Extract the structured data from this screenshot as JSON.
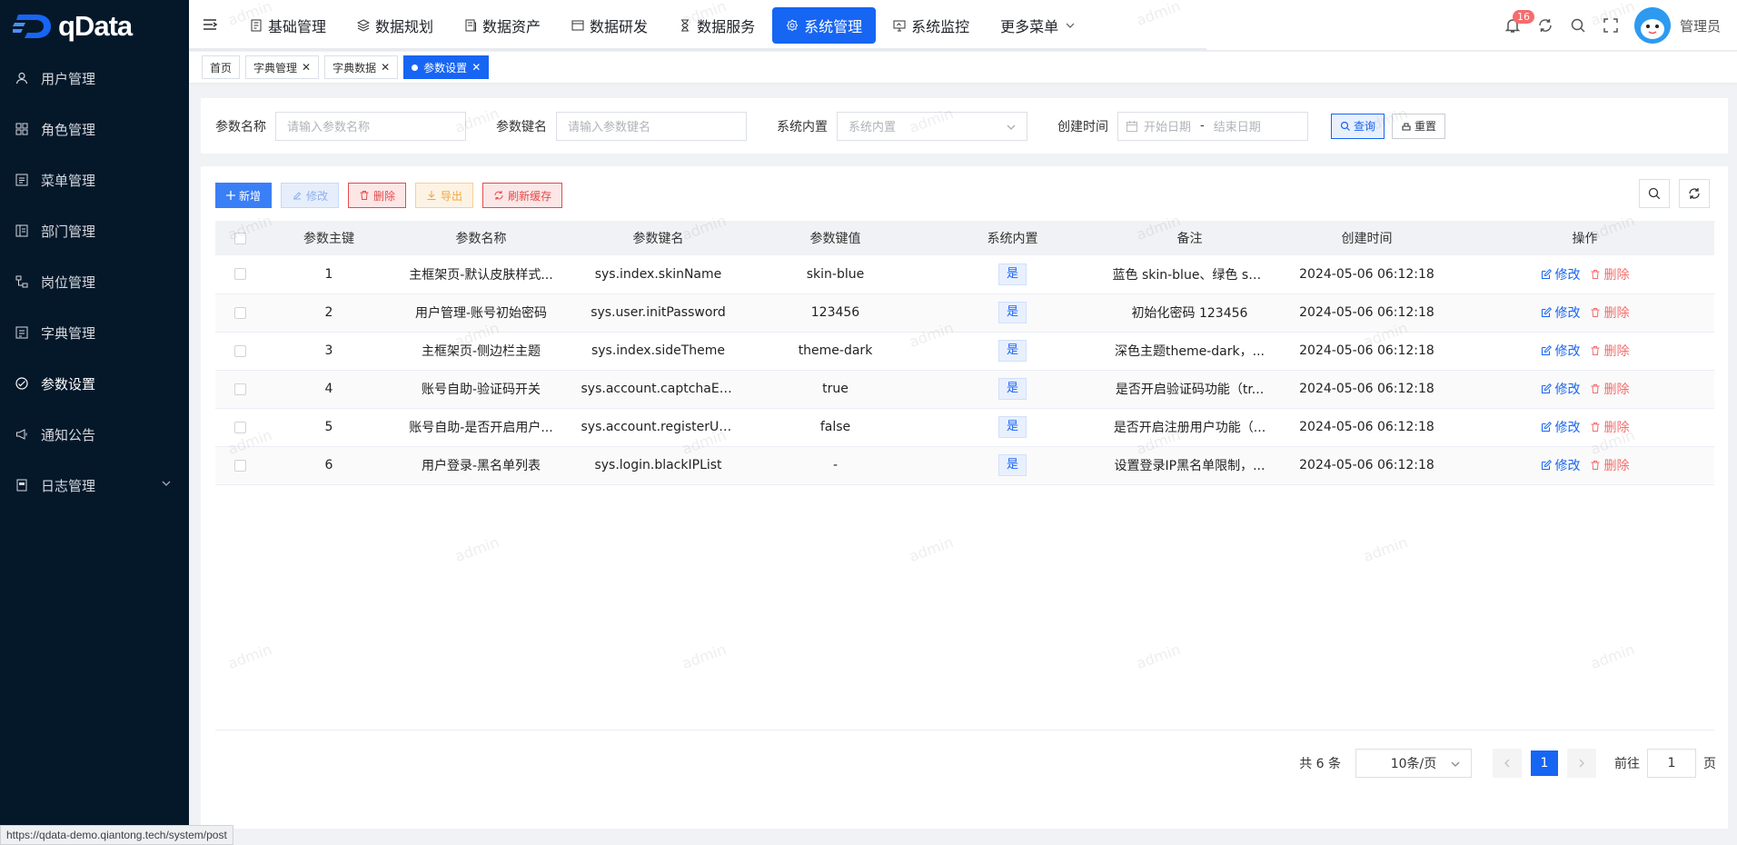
{
  "app": {
    "name": "qData",
    "watermark": "admin"
  },
  "sidebar": {
    "items": [
      {
        "label": "用户管理",
        "icon": "user-icon"
      },
      {
        "label": "角色管理",
        "icon": "role-icon"
      },
      {
        "label": "菜单管理",
        "icon": "menu-icon"
      },
      {
        "label": "部门管理",
        "icon": "dept-icon"
      },
      {
        "label": "岗位管理",
        "icon": "post-icon"
      },
      {
        "label": "字典管理",
        "icon": "dict-icon"
      },
      {
        "label": "参数设置",
        "icon": "config-icon",
        "active": true
      },
      {
        "label": "通知公告",
        "icon": "notice-icon"
      },
      {
        "label": "日志管理",
        "icon": "log-icon",
        "expandable": true
      }
    ]
  },
  "nav": {
    "items": [
      {
        "label": "基础管理"
      },
      {
        "label": "数据规划"
      },
      {
        "label": "数据资产"
      },
      {
        "label": "数据研发"
      },
      {
        "label": "数据服务"
      },
      {
        "label": "系统管理",
        "active": true
      },
      {
        "label": "系统监控"
      },
      {
        "label": "更多菜单"
      }
    ]
  },
  "header": {
    "notification_count": "16",
    "username": "管理员"
  },
  "tabs": [
    {
      "label": "首页"
    },
    {
      "label": "字典管理"
    },
    {
      "label": "字典数据"
    },
    {
      "label": "参数设置",
      "active": true
    }
  ],
  "search": {
    "name_label": "参数名称",
    "name_placeholder": "请输入参数名称",
    "key_label": "参数键名",
    "key_placeholder": "请输入参数键名",
    "builtin_label": "系统内置",
    "builtin_placeholder": "系统内置",
    "time_label": "创建时间",
    "start_placeholder": "开始日期",
    "date_sep": "-",
    "end_placeholder": "结束日期",
    "query_label": "查询",
    "reset_label": "重置"
  },
  "toolbar": {
    "add": "新增",
    "edit": "修改",
    "delete": "删除",
    "export": "导出",
    "refresh_cache": "刷新缓存"
  },
  "table": {
    "headers": [
      "参数主键",
      "参数名称",
      "参数键名",
      "参数键值",
      "系统内置",
      "备注",
      "创建时间",
      "操作"
    ],
    "edit_label": "修改",
    "delete_label": "删除",
    "rows": [
      {
        "id": "1",
        "name": "主框架页-默认皮肤样式...",
        "key": "sys.index.skinName",
        "value": "skin-blue",
        "builtin": "是",
        "remark": "蓝色 skin-blue、绿色 ski...",
        "created": "2024-05-06 06:12:18"
      },
      {
        "id": "2",
        "name": "用户管理-账号初始密码",
        "key": "sys.user.initPassword",
        "value": "123456",
        "builtin": "是",
        "remark": "初始化密码 123456",
        "created": "2024-05-06 06:12:18"
      },
      {
        "id": "3",
        "name": "主框架页-侧边栏主题",
        "key": "sys.index.sideTheme",
        "value": "theme-dark",
        "builtin": "是",
        "remark": "深色主题theme-dark，...",
        "created": "2024-05-06 06:12:18"
      },
      {
        "id": "4",
        "name": "账号自助-验证码开关",
        "key": "sys.account.captchaEna...",
        "value": "true",
        "builtin": "是",
        "remark": "是否开启验证码功能（tr...",
        "created": "2024-05-06 06:12:18"
      },
      {
        "id": "5",
        "name": "账号自助-是否开启用户...",
        "key": "sys.account.registerUser",
        "value": "false",
        "builtin": "是",
        "remark": "是否开启注册用户功能（...",
        "created": "2024-05-06 06:12:18"
      },
      {
        "id": "6",
        "name": "用户登录-黑名单列表",
        "key": "sys.login.blackIPList",
        "value": "-",
        "builtin": "是",
        "remark": "设置登录IP黑名单限制，...",
        "created": "2024-05-06 06:12:18"
      }
    ]
  },
  "pagination": {
    "total": "共 6 条",
    "page_size": "10条/页",
    "current": "1",
    "goto_label": "前往",
    "goto_value": "1",
    "page_suffix": "页"
  },
  "statusbar": {
    "url": "https://qdata-demo.qiantong.tech/system/post"
  },
  "colors": {
    "primary": "#1765f3",
    "sidebar_bg": "#05182a",
    "danger": "#f56c6c",
    "warning": "#f0a63b"
  }
}
